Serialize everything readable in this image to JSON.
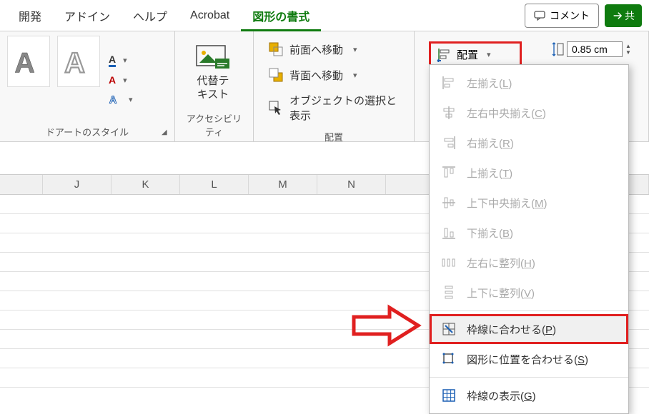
{
  "tabs": {
    "dev": "開発",
    "addin": "アドイン",
    "help": "ヘルプ",
    "acrobat": "Acrobat",
    "shapefmt": "図形の書式"
  },
  "tabs_right": {
    "comment": "コメント",
    "share": "共"
  },
  "wordart": {
    "group_label": "ドアートのスタイル"
  },
  "accessibility": {
    "alt_text": "代替テ\nキスト",
    "group_label": "アクセシビリティ"
  },
  "arrange": {
    "bring_forward": "前面へ移動",
    "send_backward": "背面へ移動",
    "selection_pane": "オブジェクトの選択と表示",
    "align_btn": "配置",
    "group_label": "配置"
  },
  "size": {
    "height": "0.85 cm"
  },
  "dropdown": {
    "align_left": "左揃え(",
    "al_k": "L",
    "align_center": "左右中央揃え(",
    "ac_k": "C",
    "align_right": "右揃え(",
    "ar_k": "R",
    "align_top": "上揃え(",
    "at_k": "T",
    "align_middle": "上下中央揃え(",
    "am_k": "M",
    "align_bottom": "下揃え(",
    "ab_k": "B",
    "dist_h": "左右に整列(",
    "dh_k": "H",
    "dist_v": "上下に整列(",
    "dv_k": "V",
    "snap_grid": "枠線に合わせる(",
    "sg_k": "P",
    "snap_shape": "図形に位置を合わせる(",
    "ss_k": "S",
    "show_grid": "枠線の表示(",
    "gl_k": "G"
  },
  "columns": [
    "J",
    "K",
    "L",
    "M",
    "N"
  ]
}
